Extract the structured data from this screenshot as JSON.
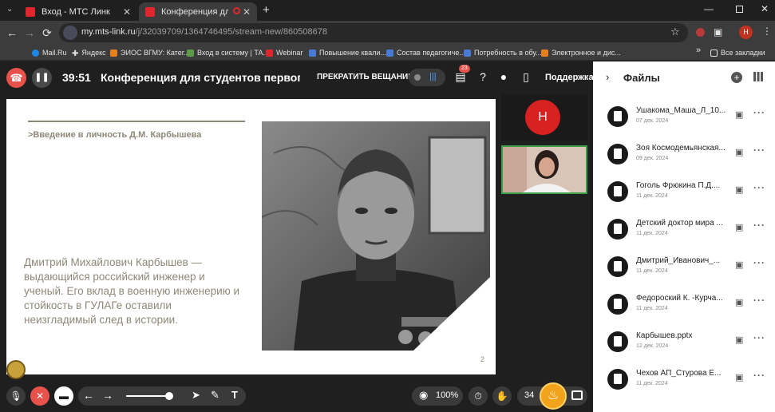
{
  "browser": {
    "tabs": [
      {
        "title": "Вход - МТС Линк",
        "active": false
      },
      {
        "title": "Конференция для студентов",
        "active": true
      }
    ],
    "url_host": "my.mts-link.ru",
    "url_path": "/j/32039709/1364746495/stream-new/860508678",
    "profile_initial": "Н",
    "bookmarks": [
      "Mail.Ru",
      "Яндекс",
      "ЭИОС ВГМУ: Катег...",
      "Вход в систему | ТА...",
      "Webinar",
      "Повышение квали...",
      "Состав педагогиче...",
      "Потребность в обу...",
      "Электронное и дис..."
    ],
    "all_bookmarks": "Все закладки"
  },
  "header": {
    "timer": "39:51",
    "title": "Конференция для студентов первого ку",
    "stop_broadcast": "ПРЕКРАТИТЬ ВЕЩАНИЕ",
    "chat_badge": "23",
    "support": "Поддержка"
  },
  "slide": {
    "heading": ">Введение в личность Д.М. Карбышева",
    "body": "Дмитрий Михайлович Карбышев — выдающийся российский инженер и ученый. Его вклад в военную инженерию и стойкость в ГУЛАГе оставили неизгладимый след в истории.",
    "page_number": "2"
  },
  "participants": {
    "avatar_initial": "Н"
  },
  "toolbar": {
    "zoom": "100%",
    "count": "34"
  },
  "files": {
    "title": "Файлы",
    "items": [
      {
        "name": "Ушакома_Маша_Л_10...",
        "date": "07 дек. 2024"
      },
      {
        "name": "Зоя Космодемьянская...",
        "date": "09 дек. 2024"
      },
      {
        "name": "Гоголь Фрюкина П.Д....",
        "date": "11 дек. 2024"
      },
      {
        "name": "Детский доктор мира ...",
        "date": "11 дек. 2024"
      },
      {
        "name": "Дмитрий_Иванович_...",
        "date": "11 дек. 2024"
      },
      {
        "name": "Федороский К. -Курча...",
        "date": "11 дек. 2024"
      },
      {
        "name": "Карбышев.pptx",
        "date": "12 дек. 2024"
      },
      {
        "name": "Чехов АП_Стурова Е...",
        "date": "11 дек. 2024"
      }
    ]
  },
  "colors": {
    "accent_red": "#e8524a",
    "slide_text": "#8d8877",
    "active_border": "#3b9f4a",
    "fire": "#f0a31b"
  }
}
